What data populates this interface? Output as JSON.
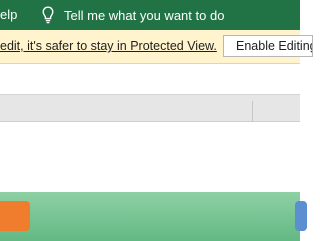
{
  "ribbon": {
    "help_tab": "elp",
    "tell_me": "Tell me what you want to do",
    "icon": "lightbulb-icon"
  },
  "protected_view": {
    "message": "edit, it's safer to stay in Protected View.",
    "enable_button": "Enable Editing"
  },
  "colors": {
    "ribbon": "#217346",
    "message_bar": "#fff4ce",
    "column_header": "#e6e6e6",
    "taskbar": "#6cbd8a",
    "taskbar_app_orange": "#f07d2e",
    "taskbar_app_blue": "#5b8fd0"
  }
}
